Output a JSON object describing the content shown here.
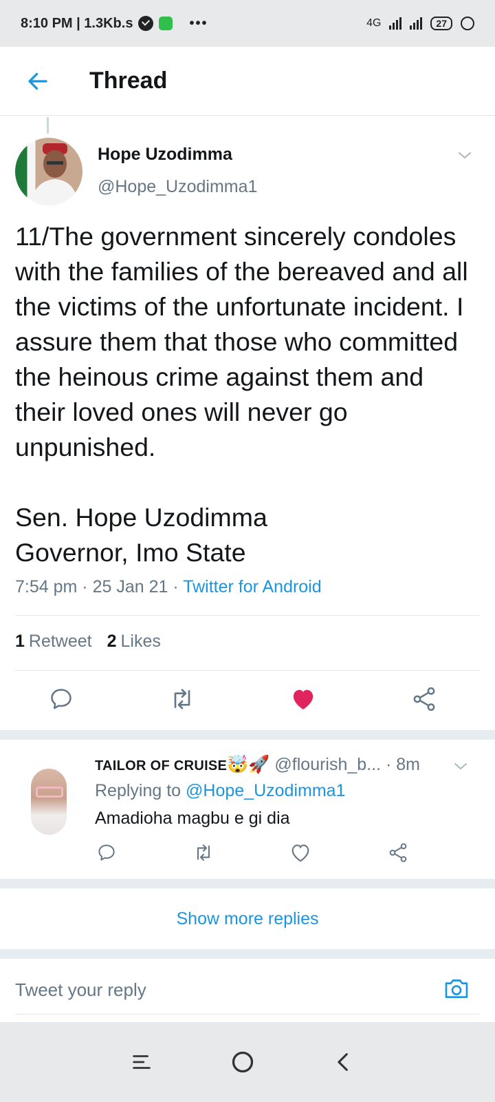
{
  "status_bar": {
    "time_speed": "8:10 PM | 1.3Kb.s",
    "more": "•••",
    "network": "4G",
    "battery": "27"
  },
  "header": {
    "title": "Thread"
  },
  "tweet": {
    "author_name": "Hope Uzodimma",
    "author_handle": "@Hope_Uzodimma1",
    "text": "11/The government sincerely condoles with the families of the bereaved and all the victims of the unfortunate incident. I assure them that those who committed the heinous crime against them and their loved ones will never go unpunished.\n\nSen. Hope Uzodimma\nGovernor, Imo State",
    "time": "7:54 pm",
    "date": "25 Jan 21",
    "source": "Twitter for Android",
    "retweets_count": "1",
    "retweets_label": "Retweet",
    "likes_count": "2",
    "likes_label": "Likes",
    "liked": true
  },
  "reply": {
    "author_name": "TAILOR OF CRUISE",
    "author_emoji": "🤯🚀",
    "author_handle": "@flourish_b...",
    "age": "· 8m",
    "replying_prefix": "Replying to",
    "replying_to": "@Hope_Uzodimma1",
    "text": "Amadioha magbu e gi dia"
  },
  "show_more": "Show more replies",
  "compose": {
    "placeholder": "Tweet your reply"
  },
  "colors": {
    "accent": "#1b95e0",
    "like": "#e0245e",
    "muted": "#657786"
  }
}
